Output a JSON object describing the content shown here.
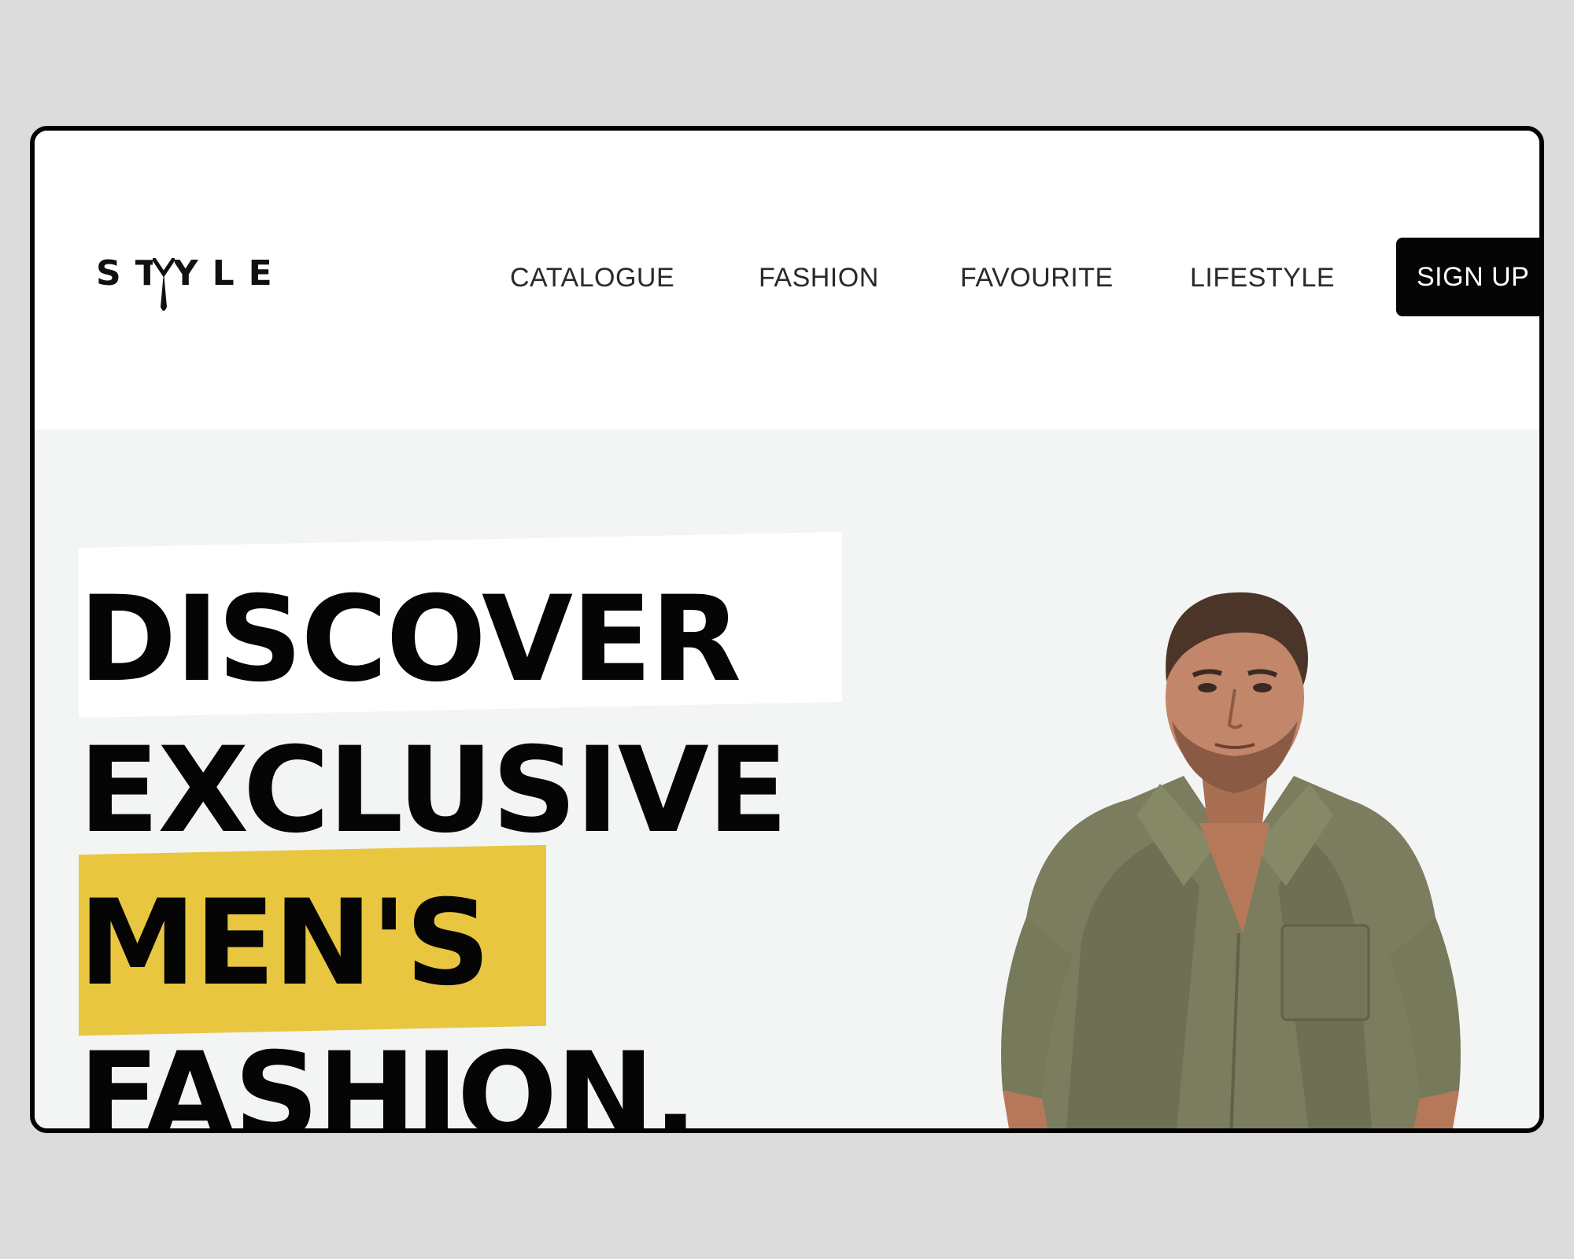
{
  "brand": {
    "logo_text": "STYLE"
  },
  "nav": {
    "items": [
      {
        "label": "CATALOGUE"
      },
      {
        "label": "FASHION"
      },
      {
        "label": "FAVOURITE"
      },
      {
        "label": "LIFESTYLE"
      }
    ],
    "signup_label": "SIGN UP"
  },
  "hero": {
    "headline_lines": [
      "DISCOVER",
      "EXCLUSIVE",
      "MEN'S",
      "FASHION."
    ],
    "highlight_color": "#e8c640",
    "background_color": "#f3f4f4",
    "image_subject": "man in olive green shirt"
  },
  "colors": {
    "accent": "#e8c640",
    "button_bg": "#050505",
    "text": "#050505"
  }
}
